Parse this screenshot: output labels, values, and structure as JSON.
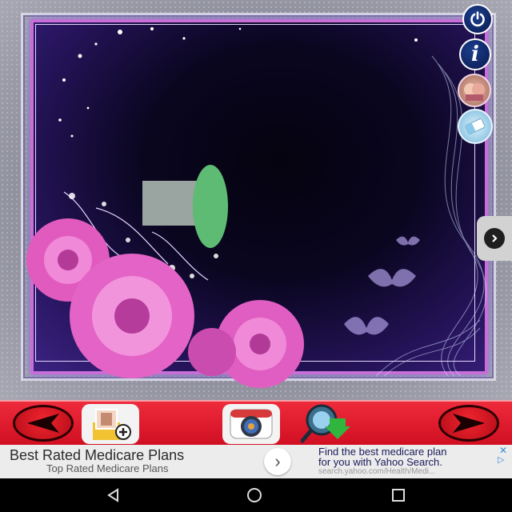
{
  "frame": {
    "theme_colors": {
      "accent": "#c76fd6",
      "dark": "#05030f",
      "purple": "#3b2382"
    }
  },
  "side_buttons": {
    "power_icon": "power-icon",
    "info_label": "i",
    "gallery_icon": "gallery-icon",
    "clear_icon": "eraser-icon",
    "next_icon": "chevron-right-icon"
  },
  "sticker": {
    "icon": "hat-sticker",
    "colors": {
      "crown": "#9aa4a0",
      "brim": "#5dbb73"
    }
  },
  "toolbar": {
    "back_icon": "arrow-left-icon",
    "add_photo_icon": "add-photo-icon",
    "camera_icon": "camera-icon",
    "search_download_icon": "search-download-icon",
    "forward_icon": "arrow-right-icon",
    "color": "#e31e2f"
  },
  "ad": {
    "title": "Best Rated Medicare Plans",
    "subtitle": "Top Rated Medicare Plans",
    "chevron": "›",
    "right_line1": "Find the best medicare plan",
    "right_line2": "for you with Yahoo Search.",
    "right_url": "search.yahoo.com/Health/Medi...",
    "close": "✕",
    "choices": "▷"
  },
  "system_nav": {
    "back": "back-icon",
    "home": "home-icon",
    "recents": "recents-icon"
  }
}
